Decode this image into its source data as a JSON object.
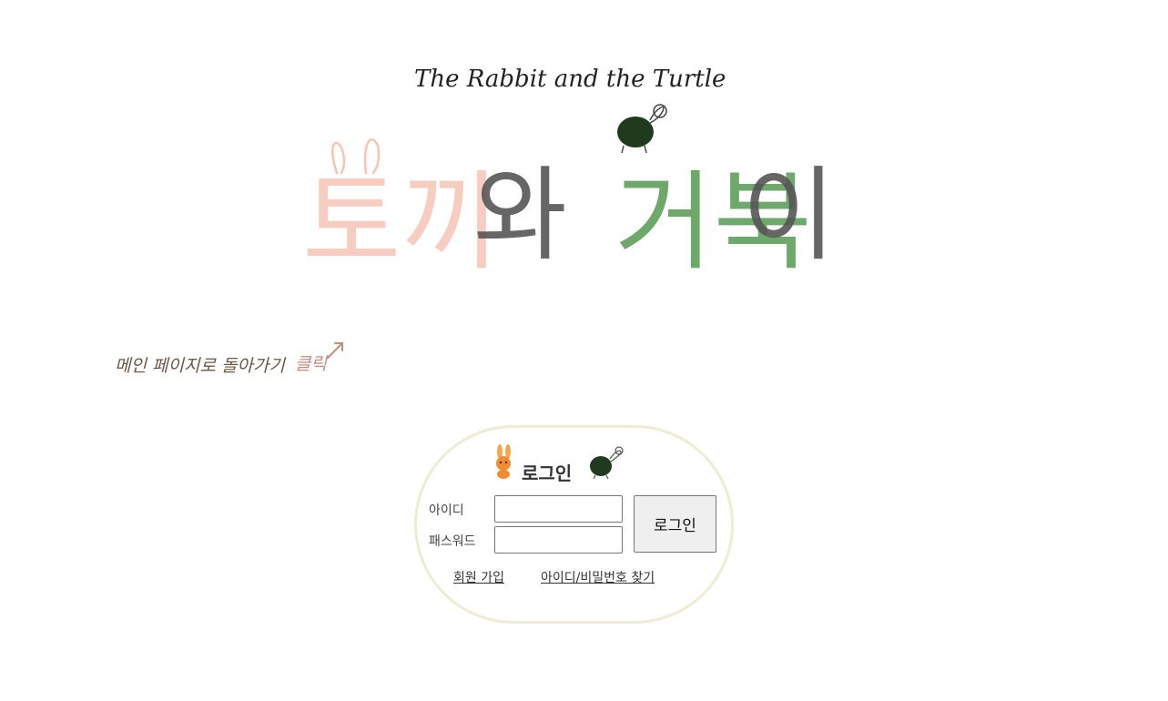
{
  "header": {
    "subtitle": "The Rabbit and the Turtle",
    "title_part_rabbit": "토끼",
    "title_part_and": "와",
    "title_part_turtle": "거북",
    "title_part_end": "이"
  },
  "home_link": {
    "label": "메인 페이지로 돌아가기",
    "click_label": "클릭"
  },
  "login": {
    "title": "로그인",
    "id_label": "아이디",
    "password_label": "패스워드",
    "id_value": "",
    "password_value": "",
    "submit_label": "로그인",
    "signup_link": "회원 가입",
    "find_link": "아이디/비밀번호 찾기"
  },
  "colors": {
    "rabbit_pink": "#f7c4b6",
    "turtle_green": "#5e9e5a",
    "turtle_shell": "#1f3a1c",
    "dark_text": "#555555",
    "box_border": "#eeecd2",
    "home_link_brown": "#6b5748",
    "click_pink": "#c98a7e"
  }
}
